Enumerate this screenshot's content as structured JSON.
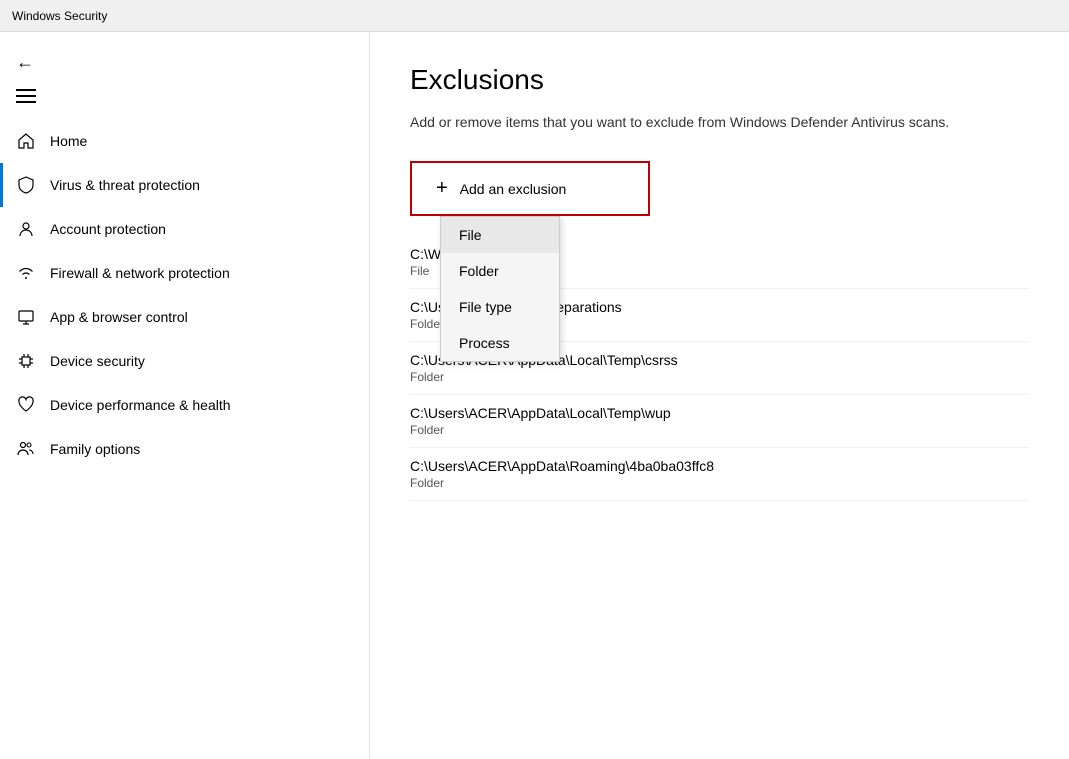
{
  "titleBar": {
    "label": "Windows Security"
  },
  "sidebar": {
    "navItems": [
      {
        "id": "home",
        "label": "Home",
        "icon": "home",
        "active": false
      },
      {
        "id": "virus",
        "label": "Virus & threat protection",
        "icon": "shield",
        "active": true
      },
      {
        "id": "account",
        "label": "Account protection",
        "icon": "person",
        "active": false
      },
      {
        "id": "firewall",
        "label": "Firewall & network protection",
        "icon": "wifi",
        "active": false
      },
      {
        "id": "appbrowser",
        "label": "App & browser control",
        "icon": "monitor",
        "active": false
      },
      {
        "id": "devicesecurity",
        "label": "Device security",
        "icon": "chip",
        "active": false
      },
      {
        "id": "deviceperformance",
        "label": "Device performance & health",
        "icon": "heart",
        "active": false
      },
      {
        "id": "family",
        "label": "Family options",
        "icon": "people",
        "active": false
      }
    ]
  },
  "content": {
    "title": "Exclusions",
    "description": "Add or remove items that you want to exclude from Windows Defender Antivirus scans.",
    "addButton": {
      "label": "Add an exclusion",
      "plusSymbol": "+"
    },
    "dropdown": {
      "items": [
        {
          "id": "file",
          "label": "File",
          "selected": true
        },
        {
          "id": "folder",
          "label": "Folder",
          "selected": false
        },
        {
          "id": "filetype",
          "label": "File type",
          "selected": false
        },
        {
          "id": "process",
          "label": "Process",
          "selected": false
        }
      ]
    },
    "exclusions": [
      {
        "path": "C:\\WIND...der.exe",
        "type": "File"
      },
      {
        "path": "C:\\Users\\...Celemony\\Separations",
        "type": "Folder"
      },
      {
        "path": "C:\\Users\\ACER\\AppData\\Local\\Temp\\csrss",
        "type": "Folder"
      },
      {
        "path": "C:\\Users\\ACER\\AppData\\Local\\Temp\\wup",
        "type": "Folder"
      },
      {
        "path": "C:\\Users\\ACER\\AppData\\Roaming\\4ba0ba03ffc8",
        "type": "Folder"
      }
    ]
  }
}
